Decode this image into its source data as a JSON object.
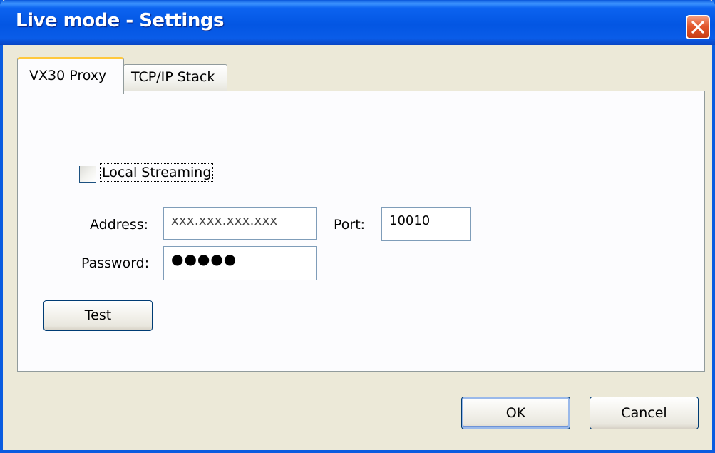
{
  "window": {
    "title": "Live mode - Settings"
  },
  "tabs": [
    {
      "label": "VX30 Proxy",
      "active": true
    },
    {
      "label": "TCP/IP Stack",
      "active": false
    }
  ],
  "proxy": {
    "local_streaming_label": "Local Streaming",
    "local_streaming_checked": false,
    "address_label": "Address:",
    "address_value": "xxx.xxx.xxx.xxx",
    "port_label": "Port:",
    "port_value": "10010",
    "password_label": "Password:",
    "password_value": "●●●●●",
    "test_label": "Test"
  },
  "footer": {
    "ok_label": "OK",
    "cancel_label": "Cancel"
  },
  "colors": {
    "titlebar": "#0356e3",
    "close_button": "#e3582d",
    "active_tab_accent": "#ffc83c",
    "dialog_background": "#ece9d8"
  }
}
